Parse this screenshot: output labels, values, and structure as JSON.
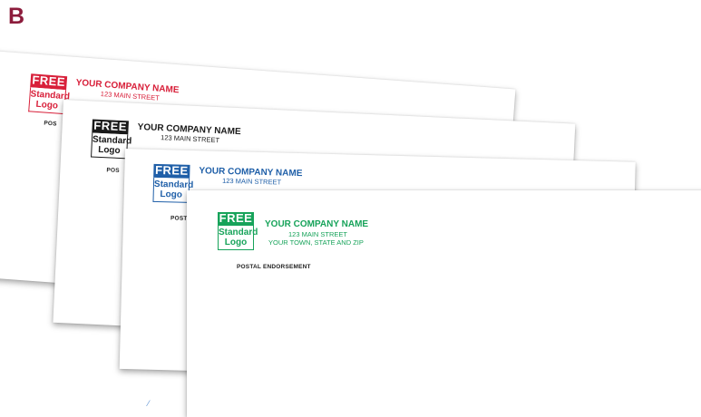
{
  "panel_letter": "B",
  "colors": {
    "panel_letter": "#8c1c3c",
    "red": "#d8203a",
    "black": "#1a1a1a",
    "blue": "#1f5fa8",
    "green": "#17a35a"
  },
  "envelopes": [
    {
      "theme": "red",
      "logo": {
        "top": "FREE",
        "line1": "Standard",
        "line2": "Logo"
      },
      "company": "YOUR COMPANY NAME",
      "street": "123 MAIN STREET",
      "city": "",
      "endorsement": "POS"
    },
    {
      "theme": "black",
      "logo": {
        "top": "FREE",
        "line1": "Standard",
        "line2": "Logo"
      },
      "company": "YOUR COMPANY NAME",
      "street": "123 MAIN STREET",
      "city": "",
      "endorsement": "POS"
    },
    {
      "theme": "blue",
      "logo": {
        "top": "FREE",
        "line1": "Standard",
        "line2": "Logo"
      },
      "company": "YOUR COMPANY NAME",
      "street": "123 MAIN STREET",
      "city": "",
      "endorsement": "POST"
    },
    {
      "theme": "green",
      "logo": {
        "top": "FREE",
        "line1": "Standard",
        "line2": "Logo"
      },
      "company": "YOUR COMPANY NAME",
      "street": "123 MAIN STREET",
      "city": "YOUR TOWN, STATE AND ZIP",
      "endorsement": "POSTAL ENDORSEMENT"
    }
  ]
}
